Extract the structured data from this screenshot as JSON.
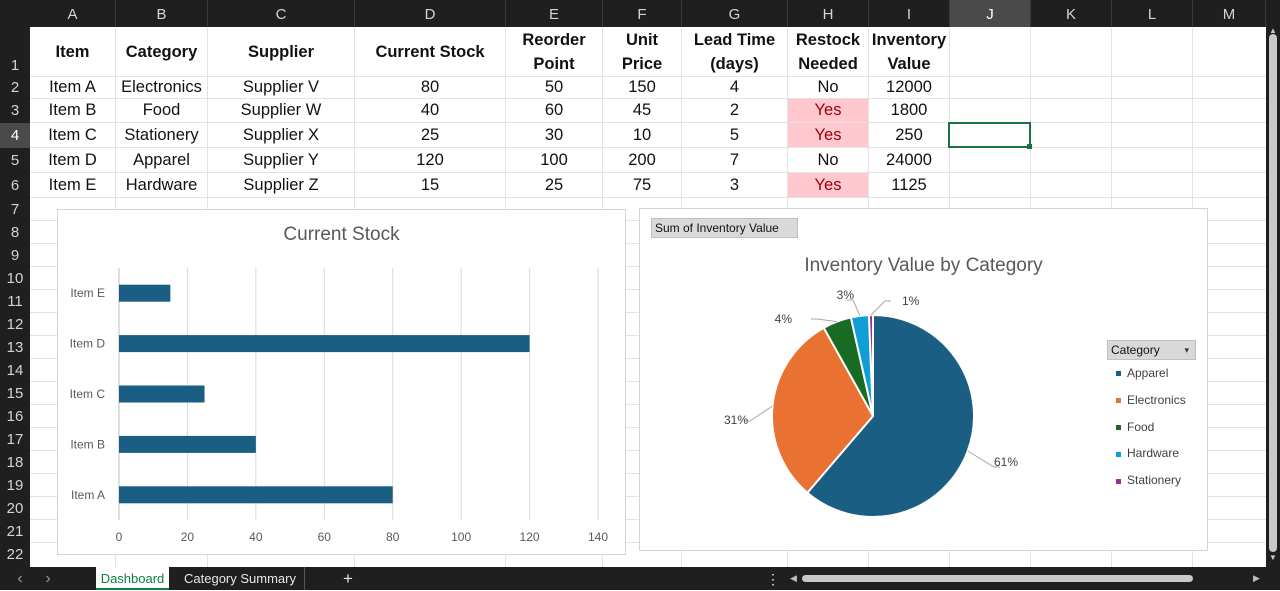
{
  "columns": [
    "A",
    "B",
    "C",
    "D",
    "E",
    "F",
    "G",
    "H",
    "I",
    "J",
    "K",
    "L",
    "M"
  ],
  "selected_column": "J",
  "rows": [
    "1",
    "2",
    "3",
    "4",
    "5",
    "6",
    "7",
    "8",
    "9",
    "10",
    "11",
    "12",
    "13",
    "14",
    "15",
    "16",
    "17",
    "18",
    "19",
    "20",
    "21",
    "22"
  ],
  "selected_row": "4",
  "headers": {
    "item": "Item",
    "category": "Category",
    "supplier": "Supplier",
    "current_stock": "Current Stock",
    "reorder_1": "Reorder",
    "reorder_2": "Point",
    "unit_1": "Unit",
    "unit_2": "Price",
    "lead_1": "Lead Time",
    "lead_2": "(days)",
    "restock_1": "Restock",
    "restock_2": "Needed",
    "invval_1": "Inventory",
    "invval_2": "Value"
  },
  "table": [
    {
      "item": "Item A",
      "category": "Electronics",
      "supplier": "Supplier V",
      "stock": "80",
      "reorder": "50",
      "price": "150",
      "lead": "4",
      "restock": "No",
      "value": "12000"
    },
    {
      "item": "Item B",
      "category": "Food",
      "supplier": "Supplier W",
      "stock": "40",
      "reorder": "60",
      "price": "45",
      "lead": "2",
      "restock": "Yes",
      "value": "1800"
    },
    {
      "item": "Item C",
      "category": "Stationery",
      "supplier": "Supplier X",
      "stock": "25",
      "reorder": "30",
      "price": "10",
      "lead": "5",
      "restock": "Yes",
      "value": "250"
    },
    {
      "item": "Item D",
      "category": "Apparel",
      "supplier": "Supplier Y",
      "stock": "120",
      "reorder": "100",
      "price": "200",
      "lead": "7",
      "restock": "No",
      "value": "24000"
    },
    {
      "item": "Item E",
      "category": "Hardware",
      "supplier": "Supplier Z",
      "stock": "15",
      "reorder": "25",
      "price": "75",
      "lead": "3",
      "restock": "Yes",
      "value": "1125"
    }
  ],
  "sheet_tabs": [
    "Dashboard",
    "Category Summary"
  ],
  "active_tab": "Dashboard",
  "add_sheet": "+",
  "nav_prev": "‹",
  "nav_next": "›",
  "more_icon": "⋮",
  "colors": {
    "bar": "#1b5e83",
    "pink_bg": "#ffc7ce",
    "pink_text": "#9c0006",
    "accent": "#117e3c"
  },
  "bar_chart": {
    "title": "Current Stock",
    "chart_data": {
      "type": "bar",
      "orientation": "horizontal",
      "categories": [
        "Item A",
        "Item B",
        "Item C",
        "Item D",
        "Item E"
      ],
      "values": [
        80,
        40,
        25,
        120,
        15
      ],
      "xlim": [
        0,
        140
      ],
      "ticks": [
        "0",
        "20",
        "40",
        "60",
        "80",
        "100",
        "120",
        "140"
      ],
      "grid": true
    }
  },
  "pie_chart": {
    "field_button": "Sum of Inventory Value",
    "title": "Inventory Value by Category",
    "legend_title": "Category",
    "legend_dropdown_icon": "▾",
    "chart_data": {
      "type": "pie",
      "labels": [
        "Apparel",
        "Electronics",
        "Food",
        "Hardware",
        "Stationery"
      ],
      "values": [
        24000,
        12000,
        1800,
        1125,
        250
      ],
      "percent_labels": [
        "61%",
        "31%",
        "4%",
        "3%",
        "1%"
      ],
      "colors": [
        "#1b5e83",
        "#e97132",
        "#196b24",
        "#0f9ed5",
        "#a02b93"
      ],
      "legend_position": "right"
    }
  }
}
